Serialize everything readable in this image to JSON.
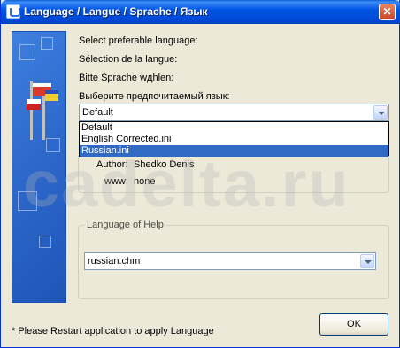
{
  "window": {
    "title": "Language / Langue / Sprache / Язык",
    "close_glyph": "✕"
  },
  "prompts": {
    "en": "Select preferable language:",
    "fr": "Sélection de la langue:",
    "de": "Bitte Sprache wдhlen:",
    "ru": "Выберите предпочитаемый язык:"
  },
  "language_select": {
    "value": "Default",
    "options": [
      "Default",
      "English Corrected.ini",
      "Russian.ini"
    ],
    "highlighted_index": 2
  },
  "info": {
    "author_label": "Author:",
    "author_value": "Shedko Denis",
    "www_label": "www:",
    "www_value": "none"
  },
  "help_group": {
    "title": "Language of Help",
    "select_value": "russian.chm"
  },
  "footer": {
    "note": "* Please Restart application to apply Language",
    "ok_label": "OK"
  },
  "watermark": "cadelta.ru",
  "colors": {
    "titlebar": "#0055e5",
    "dialog_bg": "#ece9d8",
    "selection": "#316ac5",
    "side_panel": "#2c67c9"
  },
  "icons": {
    "app": "app-window-icon",
    "side": "flags-icon",
    "dropdown": "chevron-down-icon"
  }
}
